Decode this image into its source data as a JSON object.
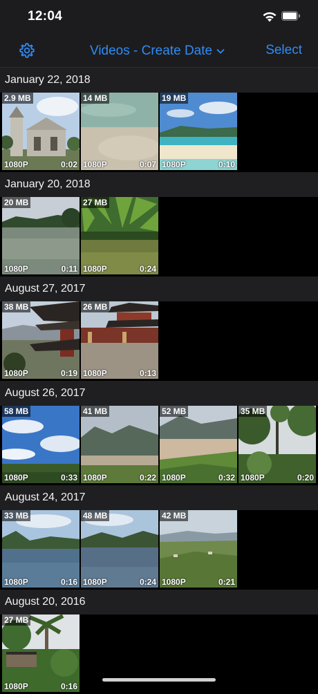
{
  "status": {
    "time": "12:04"
  },
  "nav": {
    "title": "Videos - Create Date",
    "select_label": "Select"
  },
  "colors": {
    "accent": "#2f8cf6",
    "section_bg": "#1f1f21"
  },
  "sections": [
    {
      "date": "January 22, 2018",
      "videos": [
        {
          "size": "2.9 MB",
          "res": "1080P",
          "dur": "0:02"
        },
        {
          "size": "14 MB",
          "res": "1080P",
          "dur": "0:07"
        },
        {
          "size": "19 MB",
          "res": "1080P",
          "dur": "0:10"
        }
      ]
    },
    {
      "date": "January 20, 2018",
      "videos": [
        {
          "size": "20 MB",
          "res": "1080P",
          "dur": "0:11"
        },
        {
          "size": "27 MB",
          "res": "1080P",
          "dur": "0:24"
        }
      ]
    },
    {
      "date": "August 27, 2017",
      "videos": [
        {
          "size": "38 MB",
          "res": "1080P",
          "dur": "0:19"
        },
        {
          "size": "26 MB",
          "res": "1080P",
          "dur": "0:13"
        }
      ]
    },
    {
      "date": "August 26, 2017",
      "videos": [
        {
          "size": "58 MB",
          "res": "1080P",
          "dur": "0:33"
        },
        {
          "size": "41 MB",
          "res": "1080P",
          "dur": "0:22"
        },
        {
          "size": "52 MB",
          "res": "1080P",
          "dur": "0:32"
        },
        {
          "size": "35 MB",
          "res": "1080P",
          "dur": "0:20"
        }
      ]
    },
    {
      "date": "August 24, 2017",
      "videos": [
        {
          "size": "33 MB",
          "res": "1080P",
          "dur": "0:16"
        },
        {
          "size": "48 MB",
          "res": "1080P",
          "dur": "0:24"
        },
        {
          "size": "42 MB",
          "res": "1080P",
          "dur": "0:21"
        }
      ]
    },
    {
      "date": "August 20, 2016",
      "videos": [
        {
          "size": "27 MB",
          "res": "1080P",
          "dur": "0:16"
        }
      ]
    }
  ]
}
